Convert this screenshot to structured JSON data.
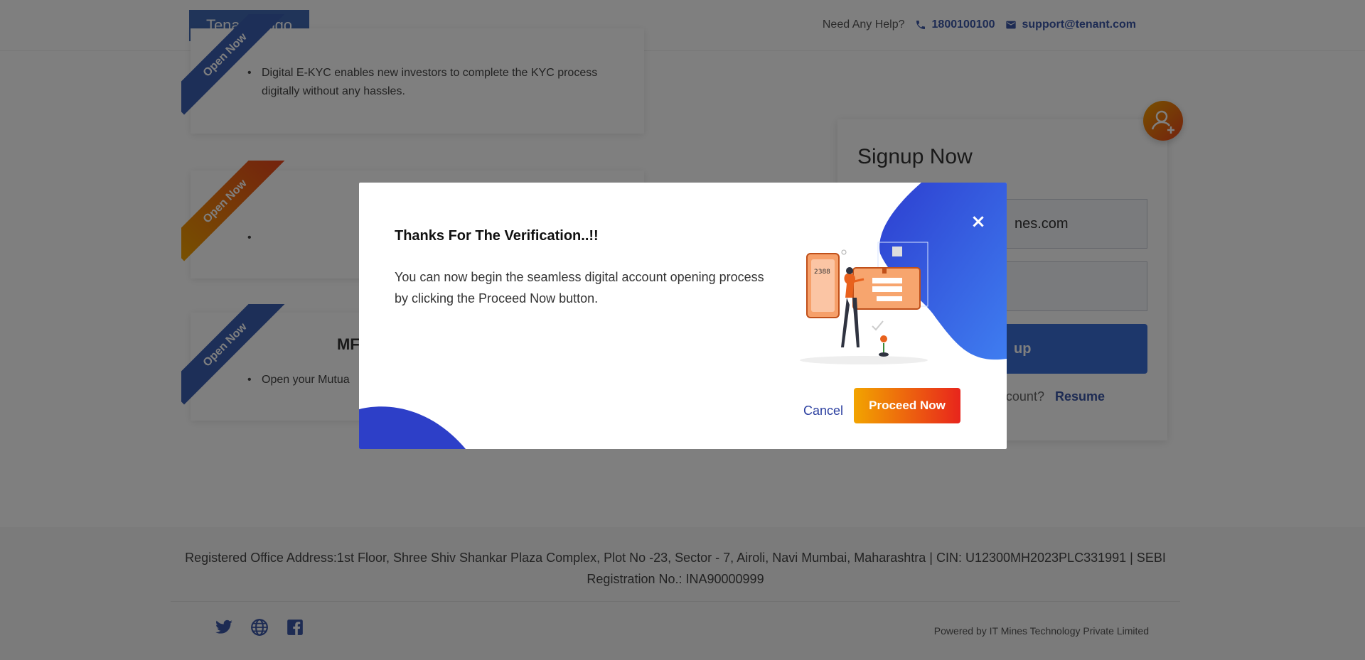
{
  "header": {
    "logo_text": "Tenant Logo",
    "help_label": "Need Any Help?",
    "phone": "1800100100",
    "email": "support@tenant.com"
  },
  "cards": [
    {
      "ribbon": "Open Now",
      "title": "",
      "text": "Digital E-KYC enables new investors to complete the KYC process digitally without any hassles."
    },
    {
      "ribbon": "Open Now",
      "title": "",
      "text": ""
    },
    {
      "ribbon": "Open Now",
      "title": "MF",
      "text": "Open your Mutua"
    }
  ],
  "signup": {
    "title": "Signup Now",
    "email_value": "nes.com",
    "second_value": "",
    "button_label": "up",
    "footer_text": "ccount?",
    "resume_label": "Resume"
  },
  "modal": {
    "title": "Thanks For The Verification..!!",
    "body": "You can now begin the seamless digital account opening process by clicking the Proceed Now button.",
    "close_label": "×",
    "cancel_label": "Cancel",
    "proceed_label": "Proceed Now",
    "illustration_code": "2388"
  },
  "footer": {
    "address": "Registered Office Address:1st Floor, Shree Shiv Shankar Plaza Complex, Plot No -23, Sector - 7, Airoli, Navi Mumbai, Maharashtra | CIN: U12300MH2023PLC331991 | SEBI Registration No.: INA90000999",
    "powered_by": "Powered by IT Mines Technology Private Limited",
    "socials": [
      "twitter-icon",
      "globe-icon",
      "facebook-icon"
    ]
  },
  "colors": {
    "brand_blue": "#4169b3",
    "accent_blue": "#2b4fd6",
    "orange_start": "#f2a400",
    "orange_end": "#e8251c",
    "overlay": "rgba(0,0,0,0.5)"
  }
}
